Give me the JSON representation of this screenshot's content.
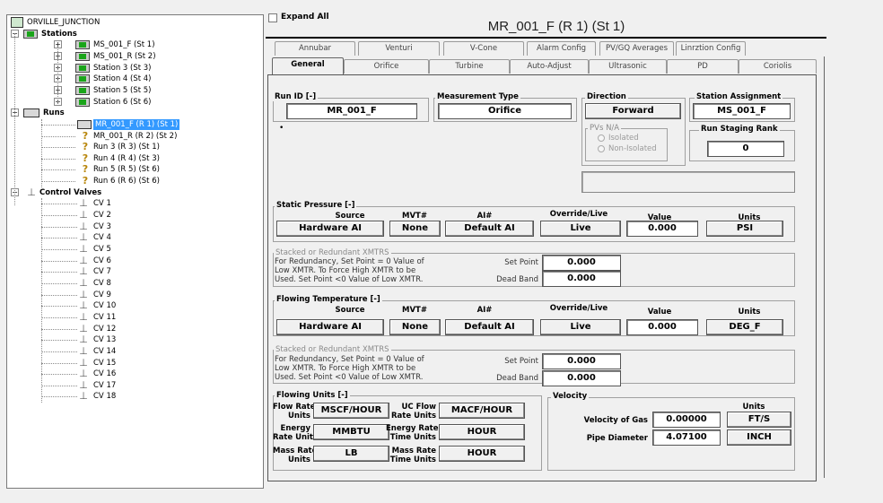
{
  "tree": {
    "root": "ORVILLE_JUNCTION",
    "stations_label": "Stations",
    "stations": [
      "MS_001_F (St 1)",
      "MS_001_R (St 2)",
      "Station 3 (St 3)",
      "Station 4 (St 4)",
      "Station 5 (St 5)",
      "Station 6 (St 6)"
    ],
    "runs_label": "Runs",
    "runs": [
      "MR_001_F (R 1) (St 1)",
      "MR_001_R (R 2) (St 2)",
      "Run 3 (R 3) (St 1)",
      "Run 4 (R 4) (St 3)",
      "Run 5 (R 5) (St 6)",
      "Run 6 (R 6) (St 6)"
    ],
    "selected_run": 0,
    "valves_label": "Control Valves",
    "valves": [
      "CV 1",
      "CV 2",
      "CV 3",
      "CV 4",
      "CV 5",
      "CV 6",
      "CV 7",
      "CV 8",
      "CV 9",
      "CV 10",
      "CV 11",
      "CV 12",
      "CV 13",
      "CV 14",
      "CV 15",
      "CV 16",
      "CV 17",
      "CV 18"
    ]
  },
  "expand_all": "Expand All",
  "title": "MR_001_F (R 1) (St 1)",
  "tabs_back": [
    "Annubar",
    "Venturi",
    "V-Cone",
    "Alarm Config",
    "PV/GQ Averages",
    "Linrztion Config"
  ],
  "tabs_front": [
    "General",
    "Orifice",
    "Turbine",
    "Auto-Adjust",
    "Ultrasonic",
    "PD",
    "Coriolis"
  ],
  "active_tab": "General",
  "run_id": {
    "label": "Run ID [-]",
    "value": "MR_001_F"
  },
  "measurement_type": {
    "label": "Measurement Type",
    "value": "Orifice"
  },
  "direction": {
    "label": "Direction",
    "value": "Forward",
    "pvs_label": "PVs N/A",
    "radio1": "Isolated",
    "radio2": "Non-Isolated"
  },
  "station_assignment": {
    "label": "Station Assignment",
    "value": "MS_001_F"
  },
  "run_staging_rank": {
    "label": "Run Staging Rank",
    "value": "0"
  },
  "headers": {
    "source": "Source",
    "mvt": "MVT#",
    "ai": "AI#",
    "override": "Override/Live",
    "value": "Value",
    "units": "Units"
  },
  "static_pressure": {
    "label": "Static Pressure [-]",
    "source": "Hardware AI",
    "mvt": "None",
    "ai": "Default AI",
    "override": "Live",
    "value": "0.000",
    "units": "PSI"
  },
  "stacked1": {
    "label": "Stacked or Redundant XMTRS",
    "text1": "For Redundancy, Set Point = 0 Value of",
    "text2": "Low XMTR.  To Force High XMTR to be",
    "text3": "Used. Set Point <0 Value of Low XMTR.",
    "set_point_label": "Set Point",
    "set_point": "0.000",
    "dead_band_label": "Dead Band",
    "dead_band": "0.000"
  },
  "flowing_temperature": {
    "label": "Flowing Temperature [-]",
    "source": "Hardware AI",
    "mvt": "None",
    "ai": "Default AI",
    "override": "Live",
    "value": "0.000",
    "units": "DEG_F"
  },
  "stacked2": {
    "label": "Stacked or Redundant XMTRS",
    "text1": "For Redundancy, Set Point = 0 Value of",
    "text2": "Low XMTR.  To Force High XMTR to be",
    "text3": "Used. Set Point <0 Value of Low XMTR.",
    "set_point_label": "Set Point",
    "set_point": "0.000",
    "dead_band_label": "Dead Band",
    "dead_band": "0.000"
  },
  "flowing_units": {
    "label": "Flowing Units [-]",
    "flow_rate_units_l1": "Flow Rate",
    "flow_rate_units_l2": "Units",
    "flow_rate_units": "MSCF/HOUR",
    "uc_flow_l1": "UC Flow",
    "uc_flow_l2": "Rate Units",
    "uc_flow": "MACF/HOUR",
    "energy_l1": "Energy",
    "energy_l2": "Rate Units",
    "energy": "MMBTU",
    "energy_time_l1": "Energy Rate",
    "energy_time_l2": "Time Units",
    "energy_time": "HOUR",
    "mass_l1": "Mass Rate",
    "mass_l2": "Units",
    "mass": "LB",
    "mass_time_l1": "Mass Rate",
    "mass_time_l2": "Time Units",
    "mass_time": "HOUR"
  },
  "velocity": {
    "label": "Velocity",
    "units_header": "Units",
    "velocity_label": "Velocity of Gas",
    "velocity_value": "0.00000",
    "velocity_units": "FT/S",
    "pipe_label": "Pipe Diameter",
    "pipe_value": "4.07100",
    "pipe_units": "INCH"
  }
}
